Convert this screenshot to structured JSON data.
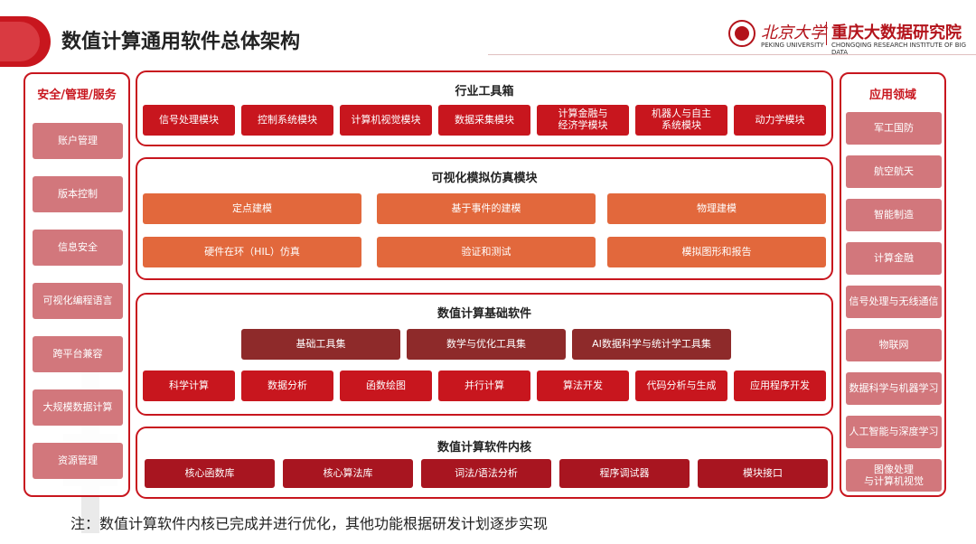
{
  "header": {
    "title": "数值计算通用软件总体架构",
    "logo_pku_cn": "北京大学",
    "logo_pku_en": "PEKING UNIVERSITY",
    "logo_inst_cn": "重庆大数据研究院",
    "logo_inst_en": "CHONGQING RESEARCH INSTITUTE OF BIG DATA"
  },
  "left_panel": {
    "title": "安全/管理/服务",
    "items": [
      "账户管理",
      "版本控制",
      "信息安全",
      "可视化编程语言",
      "跨平台兼容",
      "大规模数据计算",
      "资源管理"
    ]
  },
  "right_panel": {
    "title": "应用领域",
    "items": [
      "军工国防",
      "航空航天",
      "智能制造",
      "计算金融",
      "信号处理与无线通信",
      "物联网",
      "数据科学与机器学习",
      "人工智能与深度学习",
      "图像处理\n与计算机视觉"
    ]
  },
  "toolbox": {
    "title": "行业工具箱",
    "items": [
      "信号处理模块",
      "控制系统模块",
      "计算机视觉模块",
      "数据采集模块",
      "计算金融与\n经济学模块",
      "机器人与自主\n系统模块",
      "动力学模块"
    ]
  },
  "simulation": {
    "title": "可视化模拟仿真模块",
    "items": [
      "定点建模",
      "基于事件的建模",
      "物理建模",
      "硬件在环（HIL）仿真",
      "验证和测试",
      "模拟图形和报告"
    ]
  },
  "base": {
    "title": "数值计算基础软件",
    "toolsets": [
      "基础工具集",
      "数学与优化工具集",
      "AI数据科学与统计学工具集"
    ],
    "items": [
      "科学计算",
      "数据分析",
      "函数绘图",
      "并行计算",
      "算法开发",
      "代码分析与生成",
      "应用程序开发"
    ]
  },
  "kernel": {
    "title": "数值计算软件内核",
    "items": [
      "核心函数库",
      "核心算法库",
      "词法/语法分析",
      "程序调试器",
      "模块接口"
    ]
  },
  "note": "注：数值计算软件内核已完成并进行优化，其他功能根据研发计划逐步实现",
  "colors": {
    "accent_red": "#c8161e",
    "orange": "#e2683c",
    "dark_red": "#8e2a2a",
    "pink": "#d2777c"
  }
}
